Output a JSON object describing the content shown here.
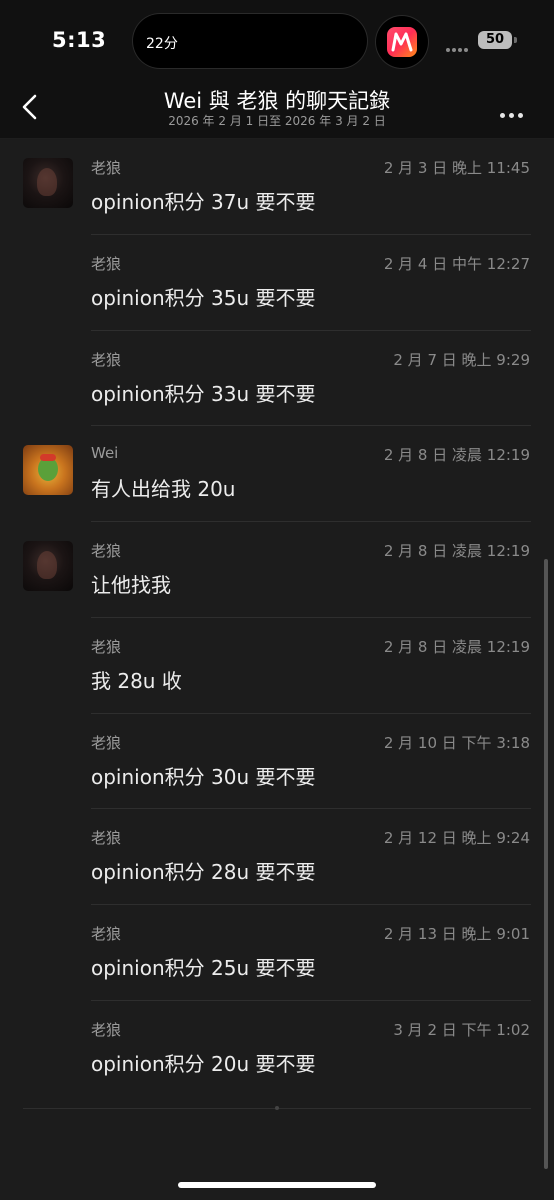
{
  "status_bar": {
    "time": "5:13",
    "island_text": "22分",
    "battery": "50"
  },
  "header": {
    "title": "Wei 與 老狼 的聊天記錄",
    "subtitle": "2026 年 2 月 1 日至 2026 年 3 月 2 日"
  },
  "messages": [
    {
      "sender": "老狼",
      "time": "2 月 3 日 晚上 11:45",
      "text": "opinion积分 37u 要不要"
    },
    {
      "sender": "老狼",
      "time": "2 月 4 日 中午 12:27",
      "text": "opinion积分 35u 要不要"
    },
    {
      "sender": "老狼",
      "time": "2 月 7 日 晚上 9:29",
      "text": "opinion积分 33u 要不要"
    },
    {
      "sender": "Wei",
      "time": "2 月 8 日 凌晨 12:19",
      "text": "有人出给我 20u"
    },
    {
      "sender": "老狼",
      "time": "2 月 8 日 凌晨 12:19",
      "text": "让他找我"
    },
    {
      "sender": "老狼",
      "time": "2 月 8 日 凌晨 12:19",
      "text": "我 28u 收"
    },
    {
      "sender": "老狼",
      "time": "2 月 10 日 下午 3:18",
      "text": "opinion积分 30u 要不要"
    },
    {
      "sender": "老狼",
      "time": "2 月 12 日 晚上 9:24",
      "text": "opinion积分 28u 要不要"
    },
    {
      "sender": "老狼",
      "time": "2 月 13 日 晚上 9:01",
      "text": "opinion积分 25u 要不要"
    },
    {
      "sender": "老狼",
      "time": "3 月 2 日 下午 1:02",
      "text": "opinion积分 20u 要不要"
    }
  ]
}
